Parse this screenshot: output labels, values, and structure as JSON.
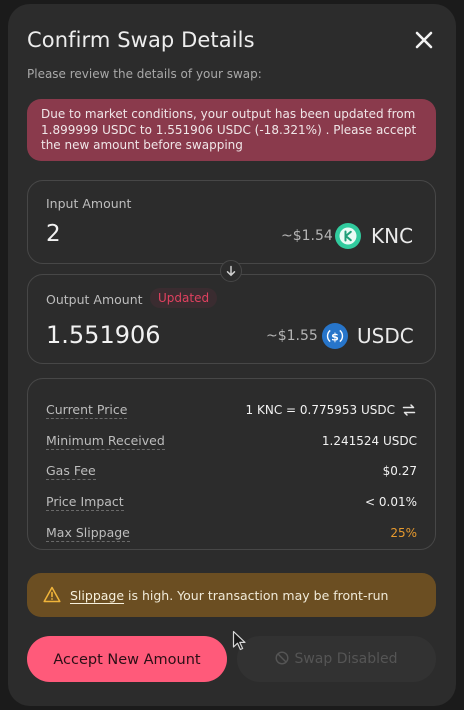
{
  "modal": {
    "title": "Confirm Swap Details",
    "subtitle": "Please review the details of your swap:",
    "notice": "Due to market conditions, your output has been updated from 1.899999 USDC to 1.551906 USDC (-18.321%) . Please accept the new amount before swapping"
  },
  "input": {
    "label": "Input Amount",
    "amount": "2",
    "usd": "~$1.54",
    "token": "KNC",
    "token_icon": "knc-token-icon",
    "token_color": "#31cb9e"
  },
  "output": {
    "label": "Output Amount",
    "badge": "Updated",
    "amount": "1.551906",
    "usd": "~$1.55",
    "token": "USDC",
    "token_icon": "usdc-token-icon",
    "token_color": "#2775ca"
  },
  "details": {
    "current_price_label": "Current Price",
    "current_price_value": "1 KNC = 0.775953 USDC",
    "minimum_received_label": "Minimum Received",
    "minimum_received_value": "1.241524 USDC",
    "gas_fee_label": "Gas Fee",
    "gas_fee_value": "$0.27",
    "price_impact_label": "Price Impact",
    "price_impact_value": "< 0.01%",
    "max_slippage_label": "Max Slippage",
    "max_slippage_value": "25%"
  },
  "warning": {
    "link": "Slippage",
    "text": " is high. Your transaction may be front-run"
  },
  "buttons": {
    "accept": "Accept New Amount",
    "disabled": "Swap Disabled"
  },
  "colors": {
    "accent": "#ff5a7a",
    "notice_bg": "#8a3a4c",
    "warning_bg": "#6b4e22",
    "slippage_warn": "#e79a2e",
    "badge_text": "#e0415f"
  }
}
